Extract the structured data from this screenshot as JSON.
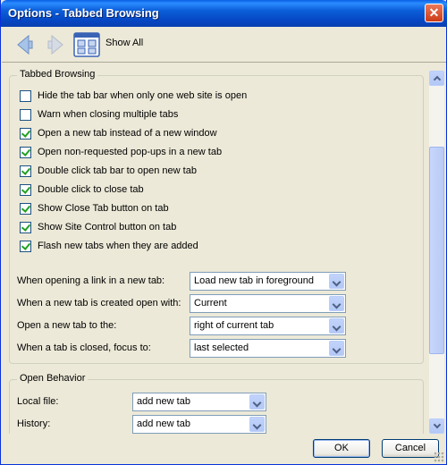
{
  "window": {
    "title": "Options - Tabbed Browsing",
    "close_icon": "close-icon"
  },
  "toolbar": {
    "show_all_label": "Show All"
  },
  "tabbed_browsing": {
    "legend": "Tabbed Browsing",
    "checkboxes": [
      {
        "label": "Hide the tab bar when only one web site is open",
        "checked": false
      },
      {
        "label": "Warn when closing multiple tabs",
        "checked": false
      },
      {
        "label": "Open a new tab instead of a new window",
        "checked": true
      },
      {
        "label": "Open non-requested pop-ups in a new tab",
        "checked": true
      },
      {
        "label": "Double click tab bar to open new tab",
        "checked": true
      },
      {
        "label": "Double click to close tab",
        "checked": true
      },
      {
        "label": "Show Close Tab button on tab",
        "checked": true
      },
      {
        "label": "Show Site Control button on tab",
        "checked": true
      },
      {
        "label": "Flash new tabs when they are added",
        "checked": true
      }
    ],
    "dropdowns": [
      {
        "label": "When opening a link in a new tab:",
        "value": "Load new tab in foreground"
      },
      {
        "label": "When a new tab is created open with:",
        "value": "Current"
      },
      {
        "label": "Open a new tab to the:",
        "value": "right of current tab"
      },
      {
        "label": "When a tab is closed, focus to:",
        "value": "last selected"
      }
    ]
  },
  "open_behavior": {
    "legend": "Open Behavior",
    "dropdowns": [
      {
        "label": "Local file:",
        "value": "add new tab"
      },
      {
        "label": "History:",
        "value": "add new tab"
      }
    ]
  },
  "buttons": {
    "ok": "OK",
    "cancel": "Cancel"
  }
}
